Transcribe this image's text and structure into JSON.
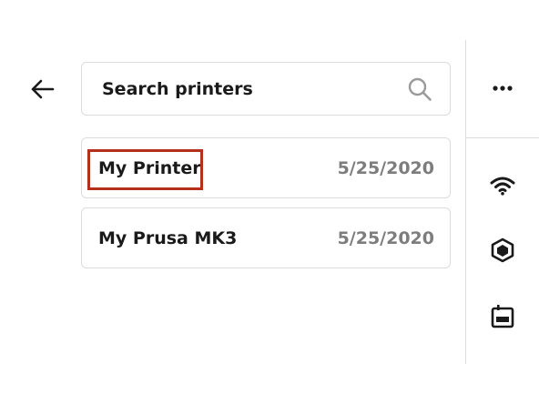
{
  "search": {
    "placeholder": "Search printers",
    "icon": "search-icon"
  },
  "printers": [
    {
      "name": "My Printer",
      "date": "5/25/2020",
      "highlighted": true
    },
    {
      "name": "My Prusa MK3",
      "date": "5/25/2020",
      "highlighted": false
    }
  ],
  "toolbar": {
    "back_icon": "arrow-left-icon",
    "more_icon": "more-horizontal-icon",
    "wifi_icon": "wifi-icon",
    "cube_icon": "cube-icon",
    "printer_icon": "printer-icon"
  },
  "colors": {
    "highlight": "#b5301c",
    "border": "#dcdcdc",
    "date": "#7d7d7d"
  }
}
